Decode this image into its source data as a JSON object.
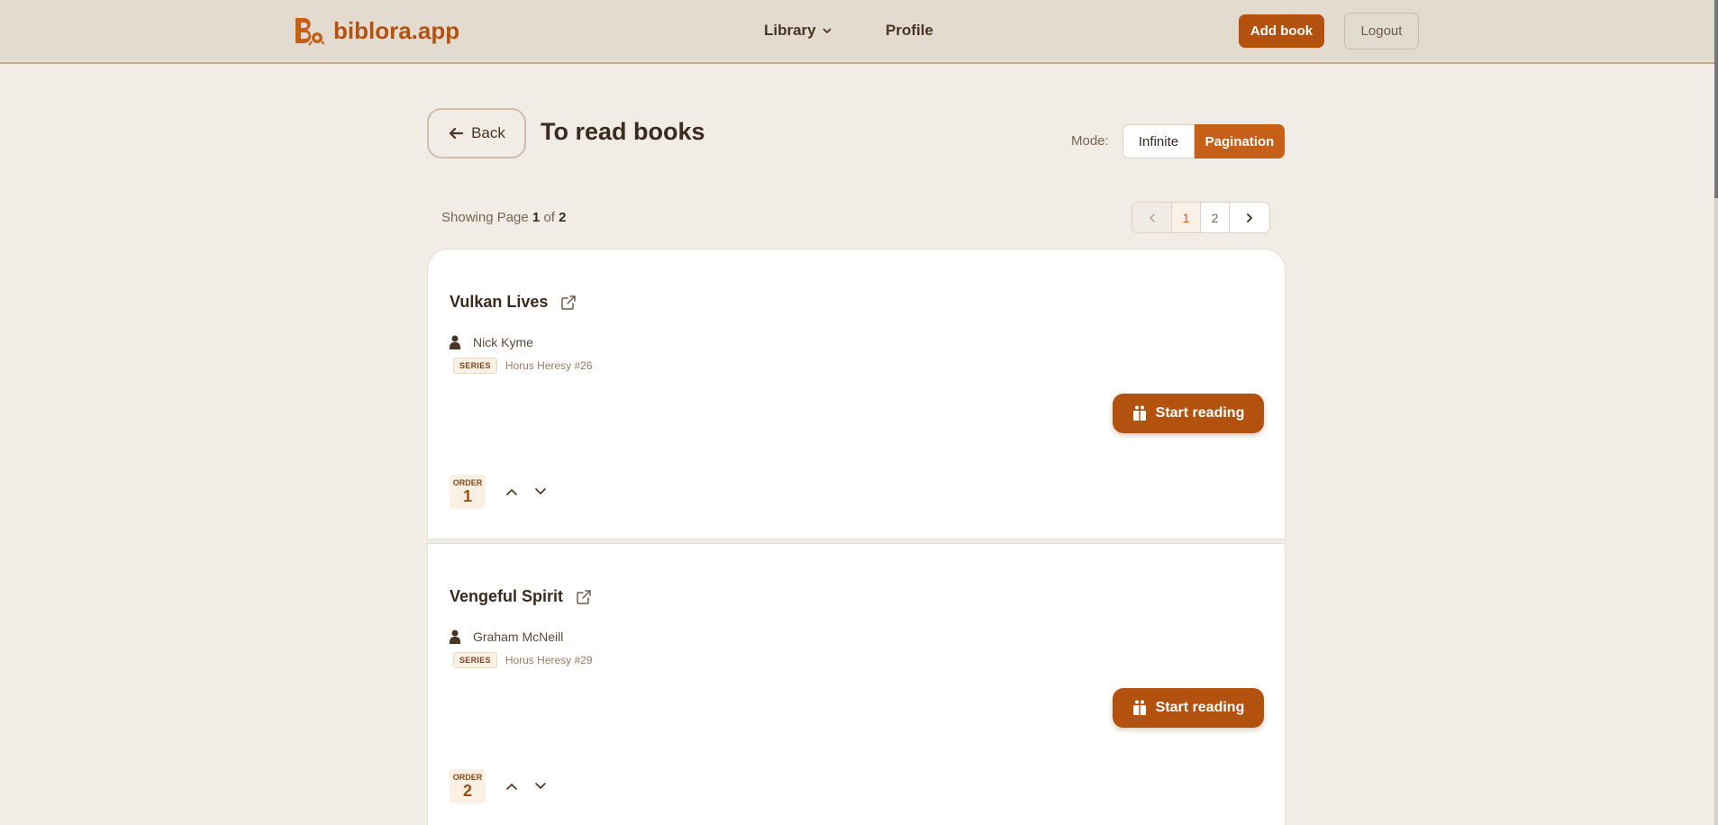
{
  "app": {
    "brand_name": "biblora.app",
    "nav": {
      "library_label": "Library",
      "profile_label": "Profile"
    },
    "add_book_label": "Add book",
    "logout_label": "Logout"
  },
  "page": {
    "back_label": "Back",
    "title": "To read books",
    "mode_label": "Mode:",
    "mode_options": [
      "Infinite",
      "Pagination"
    ],
    "mode_selected": "Pagination",
    "showing_prefix": "Showing Page",
    "current_page": "1",
    "of_label": "of",
    "total_pages": "2",
    "pages": [
      "1",
      "2"
    ]
  },
  "books": [
    {
      "title": "Vulkan Lives",
      "author": "Nick Kyme",
      "series_tag": "SERIES",
      "series": "Horus Heresy #26",
      "action_label": "Start reading",
      "order_label": "ORDER",
      "order": "1"
    },
    {
      "title": "Vengeful Spirit",
      "author": "Graham McNeill",
      "series_tag": "SERIES",
      "series": "Horus Heresy #29",
      "action_label": "Start reading",
      "order_label": "ORDER",
      "order": "2"
    }
  ],
  "colors": {
    "accent": "#b3520f",
    "background": "#f2ece6",
    "navbar": "#e4dbd0"
  },
  "icons": [
    "brand-logo-icon",
    "chevron-down-icon",
    "arrow-left-icon",
    "chevron-left-icon",
    "chevron-right-icon",
    "external-link-icon",
    "user-icon",
    "book-open-icon",
    "chevron-up-icon"
  ]
}
